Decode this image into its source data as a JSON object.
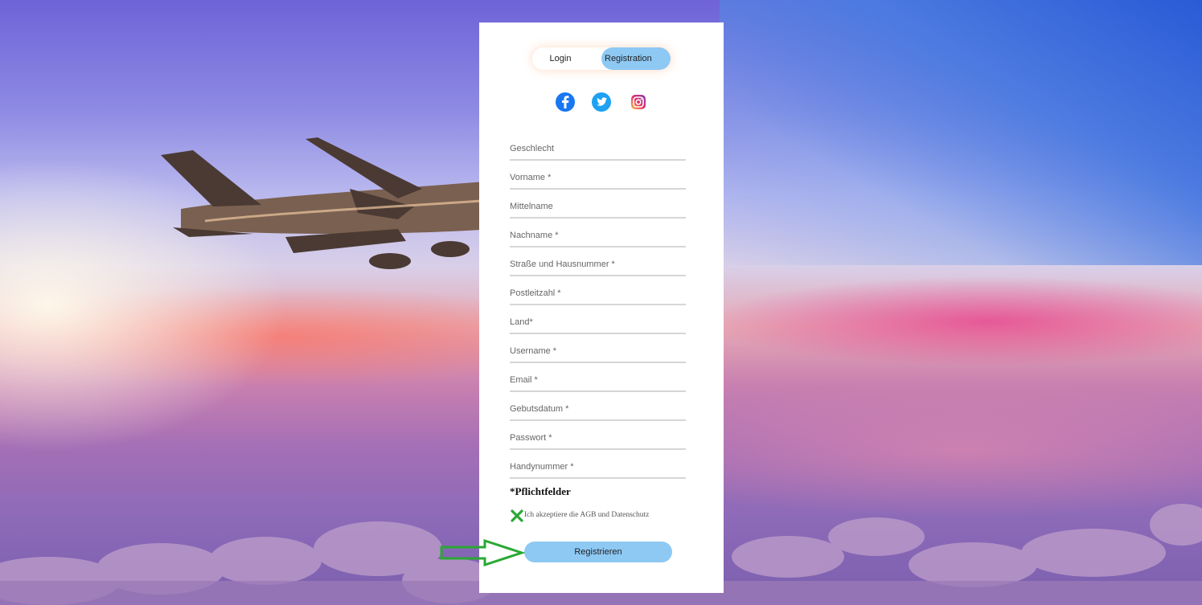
{
  "tabs": {
    "login": "Login",
    "registration": "Registration"
  },
  "social": [
    {
      "icon": "facebook-icon",
      "color": "#1877f2"
    },
    {
      "icon": "twitter-icon",
      "color": "#1da1f2"
    },
    {
      "icon": "instagram-icon",
      "color": "#d6249f"
    }
  ],
  "fields": [
    {
      "placeholder": "Geschlecht"
    },
    {
      "placeholder": "Vorname *"
    },
    {
      "placeholder": "Mittelname"
    },
    {
      "placeholder": "Nachname *"
    },
    {
      "placeholder": "Straße und Hausnummer *"
    },
    {
      "placeholder": "Postleitzahl *"
    },
    {
      "placeholder": "Land*"
    },
    {
      "placeholder": "Username *"
    },
    {
      "placeholder": "Email *"
    },
    {
      "placeholder": "Gebutsdatum *"
    },
    {
      "placeholder": "Passwort *"
    },
    {
      "placeholder": "Handynummer *"
    }
  ],
  "required_note": "*Pflichtfelder",
  "agb_label": "Ich akzeptiere die AGB und Datenschutz",
  "submit_label": "Registrieren",
  "colors": {
    "accent": "#8ec9f4",
    "annotation": "#2aa834"
  }
}
